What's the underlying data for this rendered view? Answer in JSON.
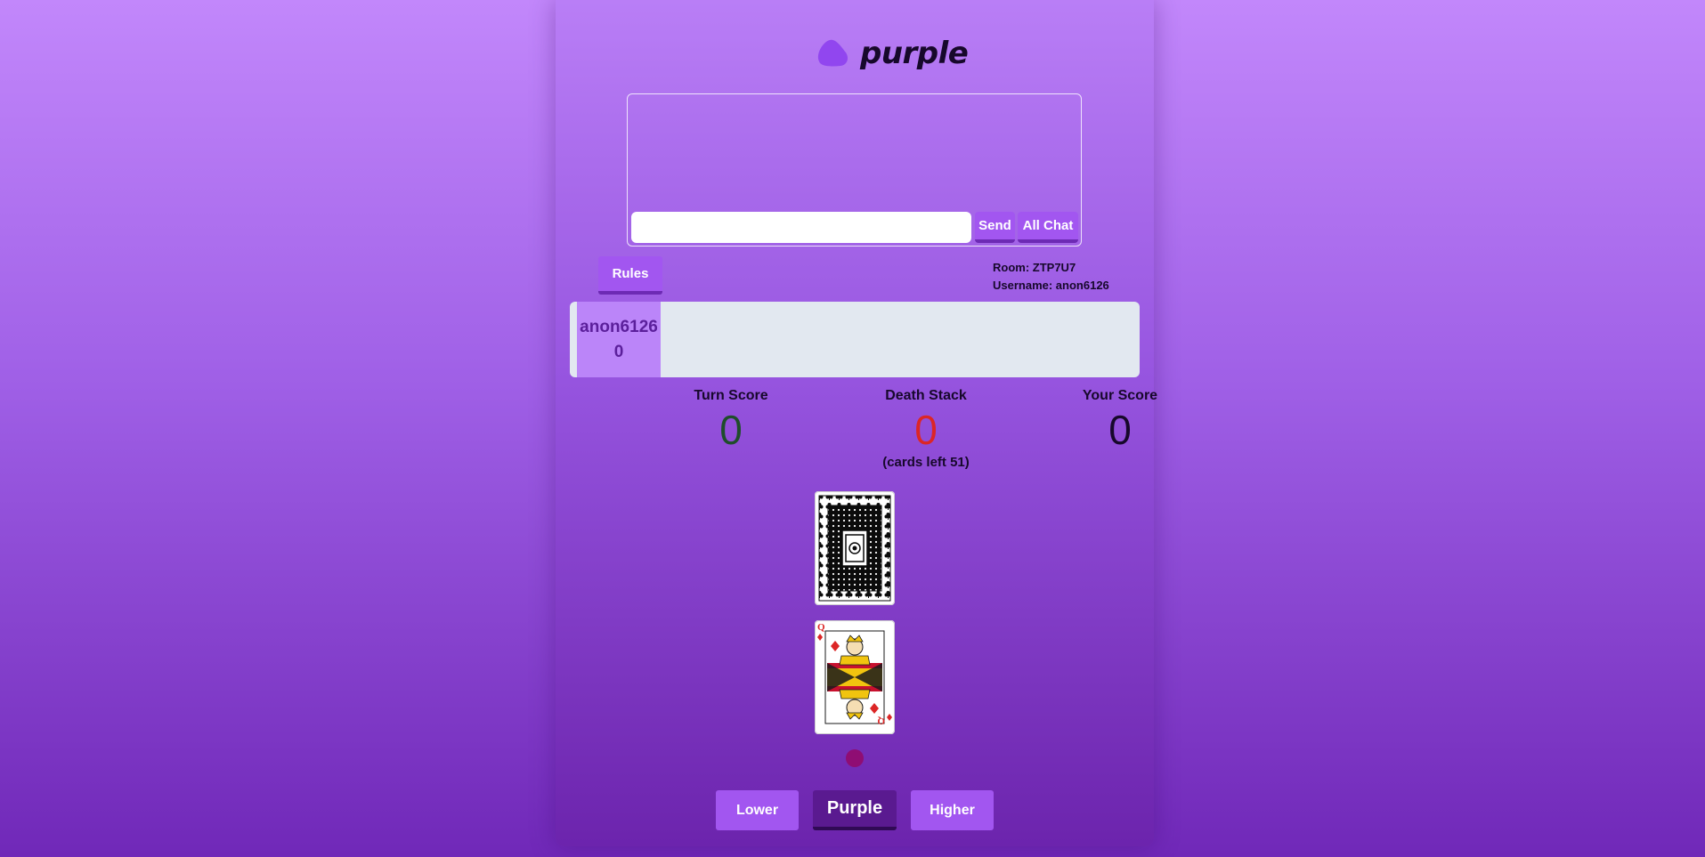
{
  "app": {
    "logo_text": "purple",
    "logo_icon": "purple-blob-icon",
    "accent_color": "#a256f0"
  },
  "chat": {
    "input_value": "",
    "input_placeholder": "",
    "send_label": "Send",
    "all_chat_label": "All Chat"
  },
  "rules_label": "Rules",
  "room": {
    "room_text": "Room: ZTP7U7",
    "username_text": "Username: anon6126"
  },
  "players": [
    {
      "name": "anon6126",
      "score": "0"
    }
  ],
  "stats": {
    "turn_score": {
      "label": "Turn Score",
      "value": "0",
      "color": "#1f4d2b"
    },
    "death_stack": {
      "label": "Death Stack",
      "value": "0",
      "color": "#dc2626",
      "sub": "(cards left 51)"
    },
    "your_score": {
      "label": "Your Score",
      "value": "0",
      "color": "#17082b"
    }
  },
  "cards": {
    "deck": "card-back-icon",
    "current": {
      "rank": "Q",
      "suit": "diamonds",
      "suit_color": "#dc2626"
    }
  },
  "indicator_color": "#8f0d73",
  "guess_buttons": {
    "lower": "Lower",
    "purple": "Purple",
    "higher": "Higher"
  }
}
